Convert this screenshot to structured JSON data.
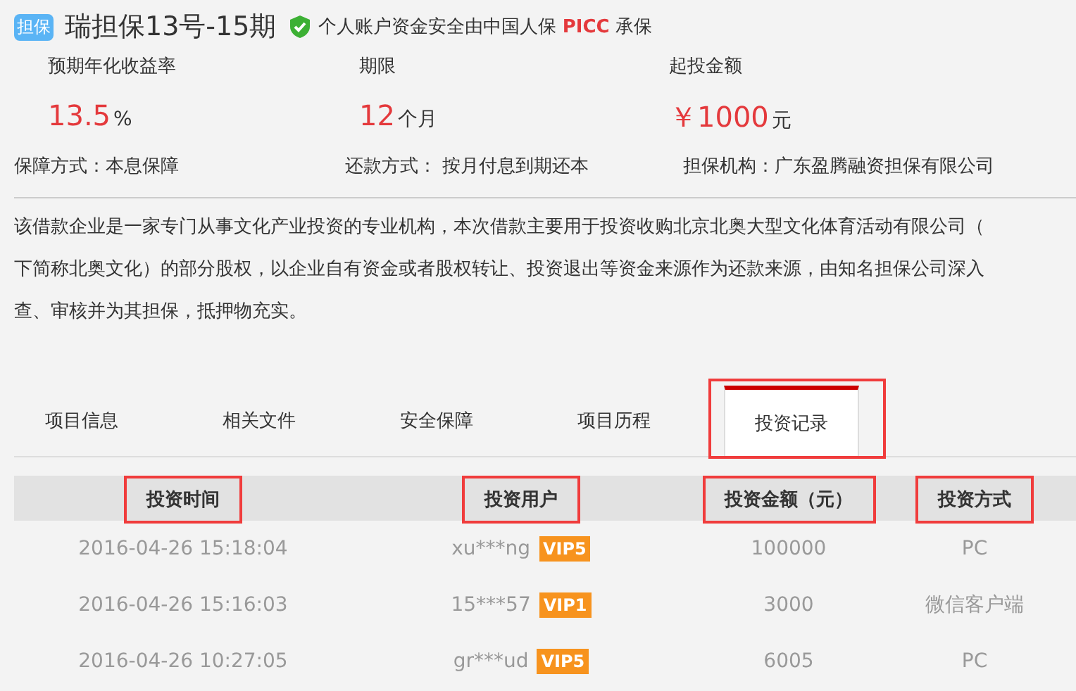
{
  "header": {
    "badge": "担保",
    "title": "瑞担保13号-15期",
    "notice": {
      "before": "个人账户资金安全由中国人保 ",
      "highlight": "PICC",
      "after": " 承保"
    }
  },
  "stats": [
    {
      "label": "预期年化收益率",
      "value": "13.5",
      "unit": "%"
    },
    {
      "label": "期限",
      "value": "12",
      "unit": "个月"
    },
    {
      "label": "起投金额",
      "value": "￥1000",
      "unit": "元"
    }
  ],
  "terms": [
    {
      "label": "保障方式：",
      "value": "本息保障"
    },
    {
      "label": "还款方式：",
      "value": " 按月付息到期还本"
    },
    {
      "label": "担保机构：",
      "value": "广东盈腾融资担保有限公司"
    }
  ],
  "description": [
    "该借款企业是一家专门从事文化产业投资的专业机构，本次借款主要用于投资收购北京北奥大型文化体育活动有限公司（",
    "下简称北奥文化）的部分股权，以企业自有资金或者股权转让、投资退出等资金来源作为还款来源，由知名担保公司深入",
    "查、审核并为其担保，抵押物充实。"
  ],
  "tabs": [
    {
      "label": "项目信息",
      "selected": false,
      "highlighted": false
    },
    {
      "label": "相关文件",
      "selected": false,
      "highlighted": false
    },
    {
      "label": "安全保障",
      "selected": false,
      "highlighted": false
    },
    {
      "label": "项目历程",
      "selected": false,
      "highlighted": false
    },
    {
      "label": "投资记录",
      "selected": true,
      "highlighted": true
    }
  ],
  "table": {
    "columns": [
      {
        "label": "投资时间",
        "highlighted": true
      },
      {
        "label": "投资用户",
        "highlighted": true
      },
      {
        "label": "投资金额（元）",
        "highlighted": true
      },
      {
        "label": "投资方式",
        "highlighted": true
      }
    ],
    "rows": [
      {
        "time": "2016-04-26 15:18:04",
        "user": "xu***ng",
        "vip": "VIP5",
        "amount": "100000",
        "method": "PC"
      },
      {
        "time": "2016-04-26 15:16:03",
        "user": "15***57",
        "vip": "VIP1",
        "amount": "3000",
        "method": "微信客户端"
      },
      {
        "time": "2016-04-26 10:27:05",
        "user": "gr***ud",
        "vip": "VIP5",
        "amount": "6005",
        "method": "PC"
      }
    ]
  }
}
